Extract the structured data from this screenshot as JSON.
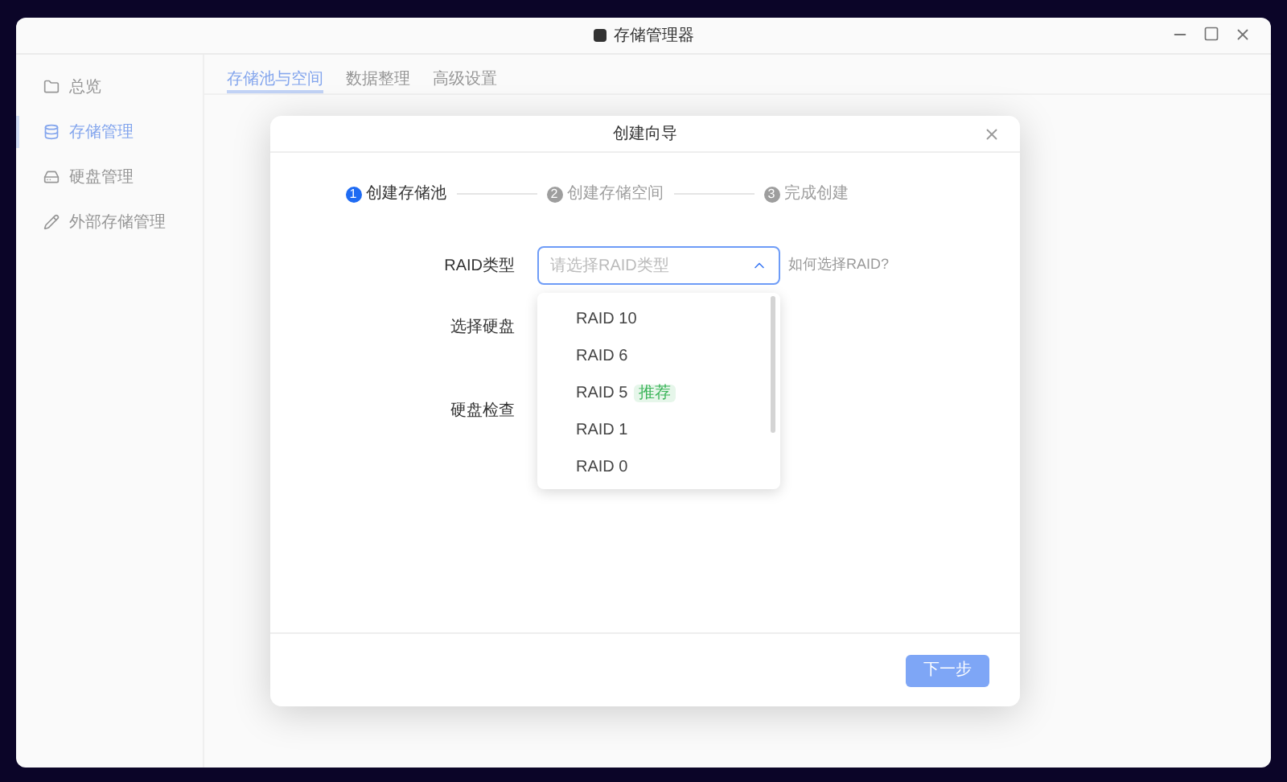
{
  "window": {
    "title": "存储管理器"
  },
  "sidebar": {
    "items": [
      {
        "label": "总览",
        "selected": false
      },
      {
        "label": "存储管理",
        "selected": true
      },
      {
        "label": "硬盘管理",
        "selected": false
      },
      {
        "label": "外部存储管理",
        "selected": false
      }
    ]
  },
  "tabs": [
    {
      "label": "存储池与空间",
      "selected": true
    },
    {
      "label": "数据整理",
      "selected": false
    },
    {
      "label": "高级设置",
      "selected": false
    }
  ],
  "dialog": {
    "title": "创建向导",
    "steps": [
      {
        "number": "1",
        "label": "创建存储池",
        "active": true
      },
      {
        "number": "2",
        "label": "创建存储空间",
        "active": false
      },
      {
        "number": "3",
        "label": "完成创建",
        "active": false
      }
    ],
    "fields": [
      {
        "label": "RAID类型",
        "kind": "select"
      },
      {
        "label": "选择硬盘",
        "kind": "blank"
      },
      {
        "label": "硬盘检查",
        "kind": "blank"
      }
    ],
    "raid_select": {
      "placeholder": "请选择RAID类型",
      "expanded": true,
      "help_link": "如何选择RAID?",
      "options": [
        {
          "label": "RAID 10"
        },
        {
          "label": "RAID 6"
        },
        {
          "label": "RAID 5",
          "badge": "推荐"
        },
        {
          "label": "RAID 1"
        },
        {
          "label": "RAID 0"
        }
      ]
    },
    "next_button": {
      "label": "下一步",
      "disabled": true
    }
  }
}
